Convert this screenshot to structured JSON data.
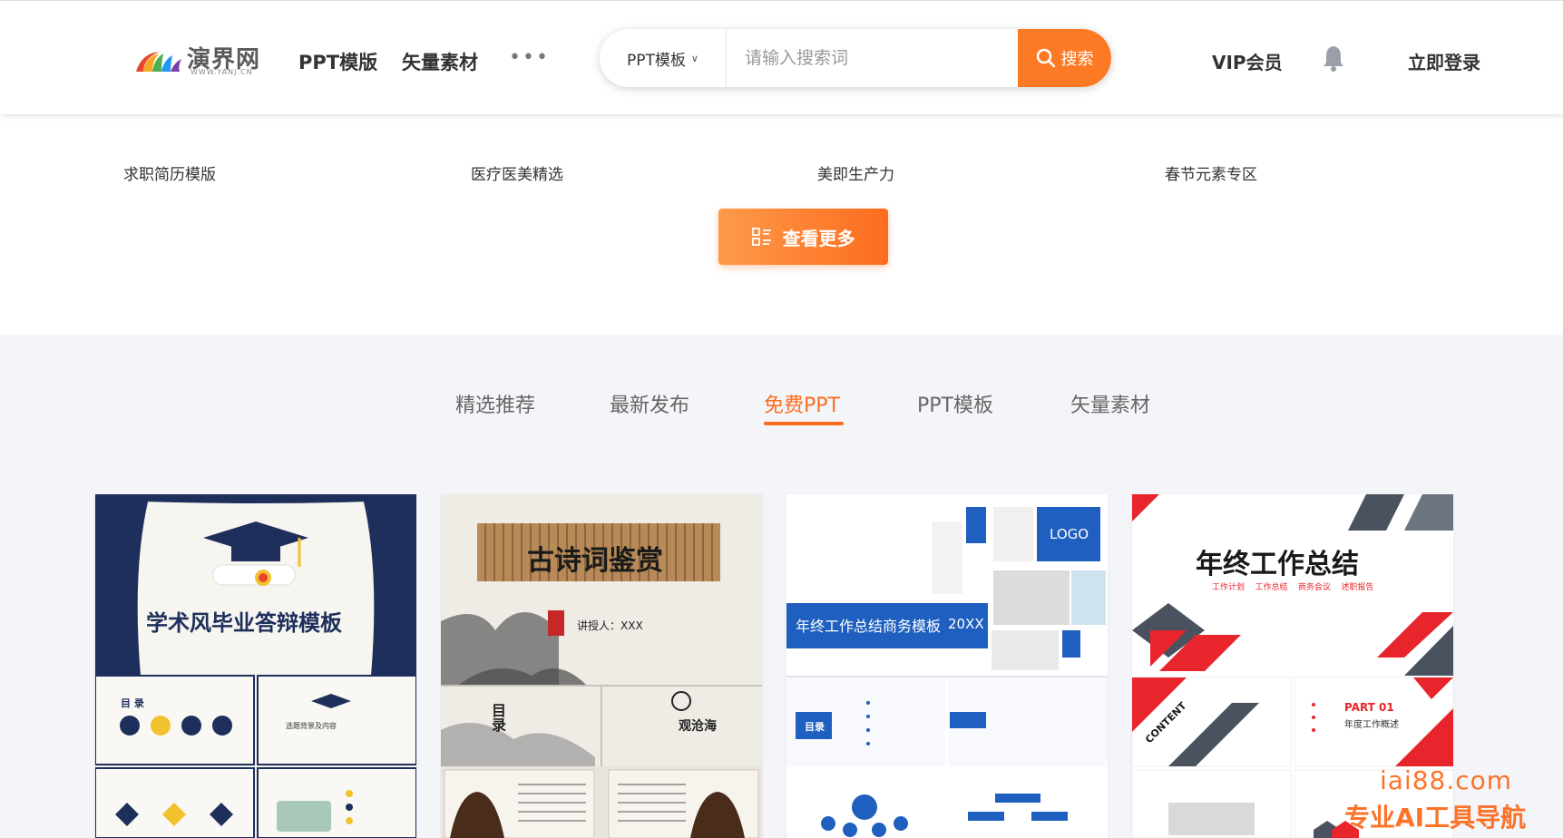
{
  "header": {
    "logo_text": "演界网",
    "logo_sub": "WWW.YANJ.CN",
    "nav": [
      "PPT模版",
      "矢量素材"
    ],
    "more": "•••",
    "search": {
      "category": "PPT模板",
      "placeholder": "请输入搜索词",
      "button": "搜索"
    },
    "vip": "VIP会员",
    "login": "立即登录"
  },
  "category_cards": [
    {
      "label": "求职简历模版"
    },
    {
      "label": "医疗医美精选"
    },
    {
      "label": "美即生产力"
    },
    {
      "label": "春节元素专区"
    }
  ],
  "more_button": "查看更多",
  "tabs": [
    "精选推荐",
    "最新发布",
    "免费PPT",
    "PPT模板",
    "矢量素材"
  ],
  "active_tab": "免费PPT",
  "templates": [
    {
      "title": "学术风毕业答辩模板",
      "toc": "目  录",
      "section": "选题背景及内容"
    },
    {
      "title": "古诗词鉴赏",
      "speaker": "讲授人：XXX",
      "toc": "目录",
      "name": "观沧海"
    },
    {
      "title": "年终工作总结商务模板",
      "year": "20XX",
      "logo": "LOGO",
      "toc": "目录"
    },
    {
      "title": "年终工作总结",
      "subtitle": "工作计划    工作总结    商务会议    述职报告",
      "part": "PART 01",
      "part_sub": "年度工作概述",
      "content": "CONTENT"
    }
  ],
  "watermark": {
    "line1": "iai88.com",
    "line2": "专业AI工具导航"
  },
  "colors": {
    "accent": "#fd6c1e",
    "navy": "#1e2f5c",
    "blue": "#1f5fbf",
    "red": "#e8252c"
  }
}
